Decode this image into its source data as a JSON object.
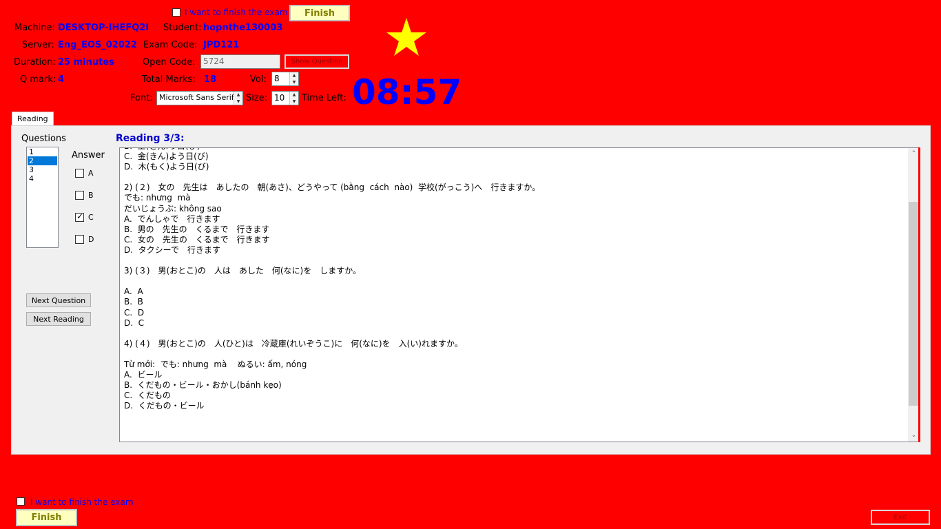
{
  "top": {
    "finish_check_label": "I want to finish the exam",
    "finish_button": "Finish"
  },
  "info": {
    "machine_label": "Machine:",
    "machine_value": "DESKTOP-IHEFQ2I",
    "student_label": "Student:",
    "student_value": "hopnthe130003",
    "server_label": "Server:",
    "server_value": "Eng_EOS_02022",
    "exam_code_label": "Exam Code:",
    "exam_code_value": "JPD121",
    "duration_label": "Duration:",
    "duration_value": "25 minutes",
    "open_code_label": "Open Code:",
    "open_code_value": "5724",
    "show_question_button": "Show Question",
    "qmark_label": "Q mark:",
    "qmark_value": "4",
    "total_marks_label": "Total Marks:",
    "total_marks_value": "18",
    "vol_label": "Vol:",
    "vol_value": "8",
    "font_label": "Font:",
    "font_value": "Microsoft Sans Serif",
    "size_label": "Size:",
    "size_value": "10",
    "time_left_label": "Time Left:",
    "time_left_value": "08:57"
  },
  "tabs": [
    {
      "label": "Reading"
    }
  ],
  "questions_panel": {
    "title": "Questions",
    "items": [
      "1",
      "2",
      "3",
      "4"
    ],
    "selected_index": 1,
    "answer_label": "Answer",
    "answers": [
      {
        "label": "A",
        "checked": false
      },
      {
        "label": "B",
        "checked": false
      },
      {
        "label": "C",
        "checked": true
      },
      {
        "label": "D",
        "checked": false
      }
    ],
    "next_question_button": "Next Question",
    "next_reading_button": "Next Reading"
  },
  "reading": {
    "title": "Reading 3/3:",
    "lines": [
      "B.  土(ど)よう日(び)",
      "C.  金(きん)よう日(び)",
      "D.  木(もく)よう日(び)",
      "",
      "2) (２)　女の　先生は　あしたの　朝(あさ)、どうやって (bằng  cách  nào)  学校(がっこう)へ　行きますか。",
      "でも: nhưng  mà",
      "だいじょうぶ: không sao",
      "A.  でんしゃで　行きます",
      "B.  男の　先生の　くるまで　行きます",
      "C.  女の　先生の　くるまで　行きます",
      "D.  タクシーで　行きます",
      "",
      "3) (３)　男(おとこ)の　人は　あした　何(なに)を　しますか。",
      "",
      "A.  A",
      "B.  B",
      "C.  D",
      "D.  C",
      "",
      "4) (４)　男(おとこ)の　人(ひと)は　冷蔵庫(れいぞうこ)に　何(なに)を　入(い)れますか。",
      "",
      "Từ mới:  でも: nhưng  mà    ぬるい: ấm, nóng",
      "A.  ビール",
      "B.  くだもの・ビール・おかし(bánh kẹo)",
      "C.  くだもの",
      "D.  くだもの・ビール"
    ]
  },
  "bottom": {
    "finish_check_label": "I want to finish the exam",
    "finish_button": "Finish",
    "exit_button": "Exit"
  },
  "colors": {
    "background": "#ff0000",
    "info_value": "#0000ff",
    "star": "#ffff00",
    "finish_button_bg": "#ffffc0"
  }
}
